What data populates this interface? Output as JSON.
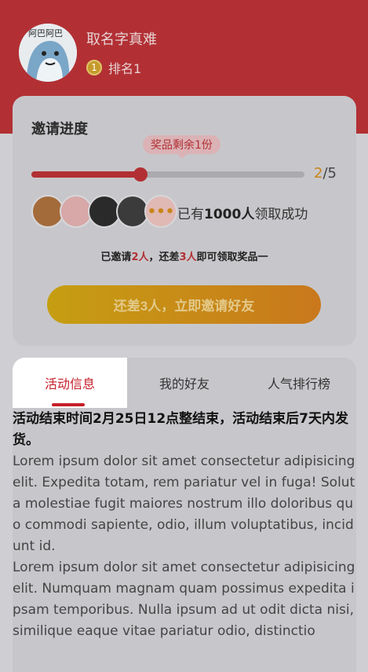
{
  "user": {
    "name": "取名字真难",
    "rank_label": "排名1",
    "medal_number": "1"
  },
  "invite": {
    "title": "邀请进度",
    "tooltip": "奖品剩余1份",
    "progress": {
      "current": "2",
      "separator": "/",
      "total": "5",
      "fraction": 0.4
    },
    "more_icon": "•••",
    "claim_prefix": "已有",
    "claim_count": "1000人",
    "claim_suffix": "领取成功",
    "note_invited_prefix": "已邀请",
    "note_invited_count": "2人",
    "note_middle": "，还差",
    "note_remaining": "3人",
    "note_suffix": "即可领取奖品一",
    "cta_label": "还差3人，立即邀请好友"
  },
  "tabs": [
    {
      "label": "活动信息",
      "active": true
    },
    {
      "label": "我的好友",
      "active": false
    },
    {
      "label": "人气排行榜",
      "active": false
    }
  ],
  "content": {
    "headline": "活动结束时间2月25日12点整结束，活动结束后7天内发货。",
    "paragraphs": [
      "Lorem ipsum dolor sit amet consectetur adipisicing elit. Expedita totam, rem pariatur vel in fuga! Soluta molestiae fugit maiores nostrum illo doloribus quo commodi sapiente, odio, illum voluptatibus, incidunt id.",
      "Lorem ipsum dolor sit amet consectetur adipisicing elit. Numquam magnam quam possimus expedita ipsam temporibus. Nulla ipsum ad ut odit dicta nisi, similique eaque vitae pariatur odio, distinctio"
    ]
  },
  "colors": {
    "brand_red": "#b23034",
    "accent_gold": "#c98519"
  }
}
